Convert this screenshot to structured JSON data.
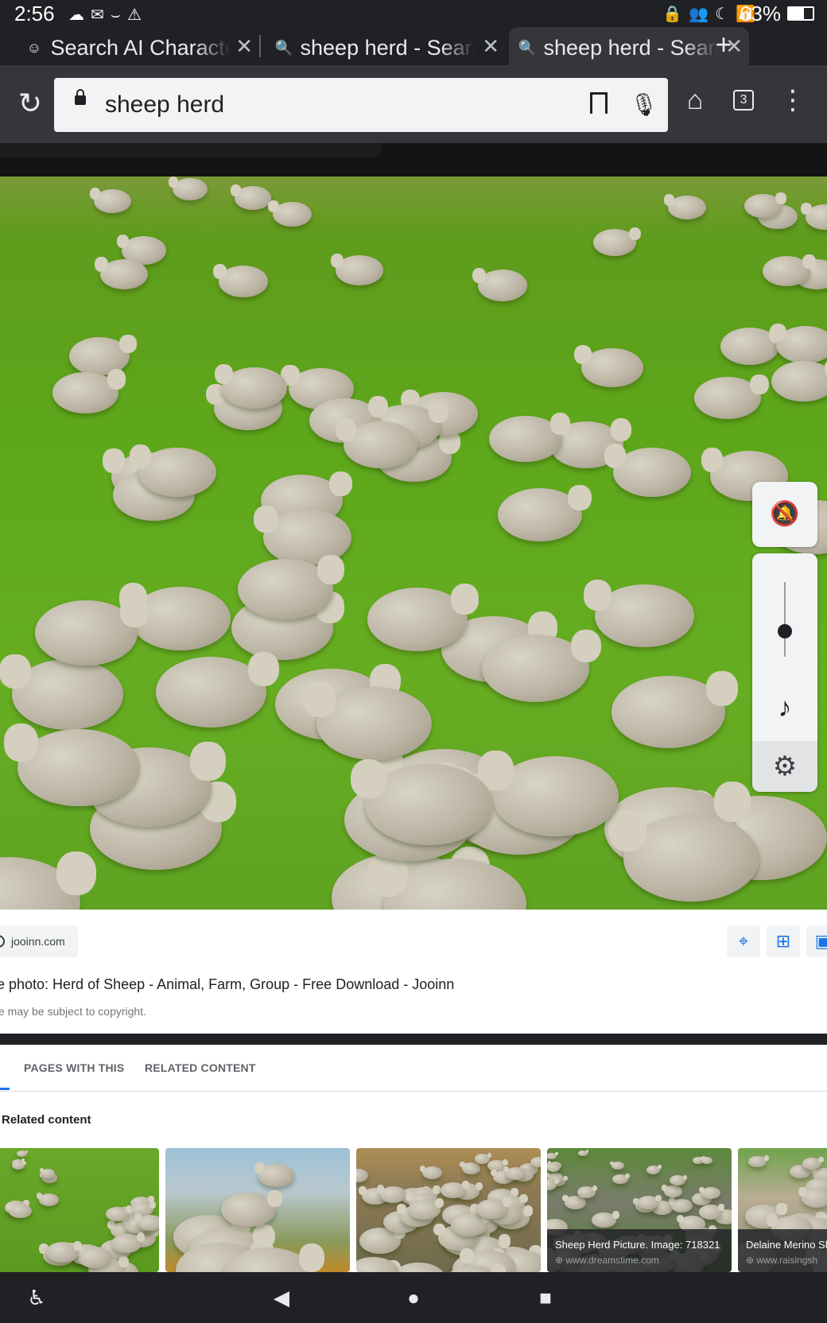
{
  "status_bar": {
    "time": "2:56",
    "notification_icons": [
      "cloud-icon",
      "mail-icon",
      "amazon-icon",
      "warning-icon"
    ],
    "system_icons": [
      "vpn-lock-icon",
      "people-icon",
      "do-not-disturb-moon-icon",
      "wifi-icon"
    ],
    "battery": "63%"
  },
  "tabs": [
    {
      "title": "Search AI Characte",
      "favicon": "character-icon",
      "active": false
    },
    {
      "title": "sheep herd - Search",
      "favicon": "search-icon",
      "active": false
    },
    {
      "title": "sheep herd - Search",
      "favicon": "search-icon",
      "active": true
    }
  ],
  "toolbar": {
    "url_text": "sheep herd",
    "tab_count": "3"
  },
  "image_viewer": {
    "source_host": "jooinn.com",
    "title": "e photo: Herd of Sheep - Animal, Farm, Group - Free Download - Jooinn",
    "copyright_note": "e may be subject to copyright.",
    "action_icons": [
      "lens-search-icon",
      "add-collection-icon",
      "image-icon"
    ]
  },
  "media_controls": {
    "icons": [
      "notifications-off-icon",
      "volume-slider",
      "music-note-icon",
      "settings-icon"
    ],
    "volume_level": 0.35
  },
  "content_tabs": [
    "PAGES WITH THIS",
    "RELATED CONTENT"
  ],
  "related": {
    "heading": "Related content",
    "items": [
      {
        "caption": "",
        "source": ""
      },
      {
        "caption": "",
        "source": ""
      },
      {
        "caption": "",
        "source": ""
      },
      {
        "caption": "Sheep Herd Picture. Image: 718321",
        "source": "www.dreamstime.com"
      },
      {
        "caption": "Delaine Merino Sh",
        "source": "www.raisingsh"
      }
    ]
  },
  "colors": {
    "browser_chrome": "#35363a",
    "status_bar": "#202124",
    "accent": "#1a73e8",
    "grass": "#5ea71b"
  }
}
